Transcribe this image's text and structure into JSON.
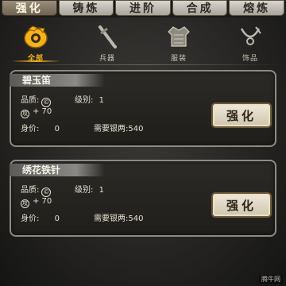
{
  "tabs": [
    {
      "label": "强化",
      "active": true
    },
    {
      "label": "铸炼",
      "active": false
    },
    {
      "label": "进阶",
      "active": false
    },
    {
      "label": "合成",
      "active": false
    },
    {
      "label": "熔炼",
      "active": false
    }
  ],
  "categories": [
    {
      "label": "全部",
      "icon": "all-items-icon",
      "active": true
    },
    {
      "label": "兵器",
      "icon": "sword-icon",
      "active": false
    },
    {
      "label": "服装",
      "icon": "armor-icon",
      "active": false
    },
    {
      "label": "饰品",
      "icon": "necklace-icon",
      "active": false
    }
  ],
  "items": [
    {
      "name": "碧玉笛",
      "quality_label": "品质:",
      "level_label": "级别:",
      "level": "1",
      "attack": "+ 70",
      "price_label": "身价:",
      "price": "0",
      "cost_label": "需要银两:",
      "cost": "540",
      "button": "强化"
    },
    {
      "name": "绣花铁针",
      "quality_label": "品质:",
      "level_label": "级别:",
      "level": "1",
      "attack": "+ 70",
      "price_label": "身价:",
      "price": "0",
      "cost_label": "需要银两:",
      "cost": "540",
      "button": "强化"
    }
  ],
  "watermark": "腾牛网",
  "colors": {
    "accent": "#f4b21d",
    "card_border": "#8d8a84"
  }
}
